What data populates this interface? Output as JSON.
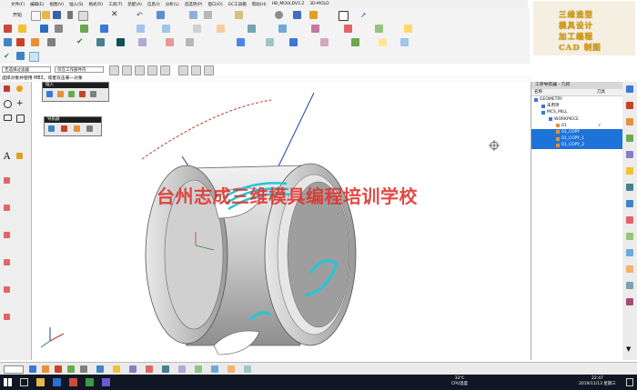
{
  "menu": [
    "文件(F)",
    "编辑(E)",
    "视图(V)",
    "插入(S)",
    "格式(R)",
    "工具(T)",
    "装配(A)",
    "信息(I)",
    "分析(L)",
    "首选项(P)",
    "窗口(O)",
    "GC工具箱",
    "帮助(H)",
    "HB_MOULDV5.2",
    "3D-MOLD"
  ],
  "brand": [
    "三维造型",
    "模具设计",
    "加工编程",
    "CAD 制图"
  ],
  "toolbar": {
    "start_label": "开始"
  },
  "combo": {
    "filter": "无选择过滤器",
    "scope": "仅在工作部件内"
  },
  "status_text": "选择对象并使用 MB3，或者双击某一对象",
  "float_insert": {
    "title": "插入"
  },
  "float_nav": {
    "title": "导航器"
  },
  "nav": {
    "title": "工序导航器 - 几何",
    "col_name": "名称",
    "col_tool": "刀具",
    "rows": [
      {
        "label": "GEOMETRY",
        "indent": 0,
        "selected": false,
        "check": ""
      },
      {
        "label": "未用项",
        "indent": 1,
        "selected": false,
        "check": ""
      },
      {
        "label": "MCS_MILL",
        "indent": 1,
        "selected": false,
        "check": ""
      },
      {
        "label": "WORKPIECE",
        "indent": 2,
        "selected": false,
        "check": ""
      },
      {
        "label": "01",
        "indent": 3,
        "selected": false,
        "check": "✔"
      },
      {
        "label": "01_COPY",
        "indent": 3,
        "selected": true,
        "check": ""
      },
      {
        "label": "01_COPY_1",
        "indent": 3,
        "selected": true,
        "check": ""
      },
      {
        "label": "01_COPY_2",
        "indent": 3,
        "selected": true,
        "check": ""
      }
    ]
  },
  "watermark": "台州志成三维模具编程培训学校",
  "taskbar": {
    "time": "22:47",
    "date": "2019/11/13 星期三",
    "cpu": "33℃",
    "cpu_label": "CPU温度"
  },
  "colors": {
    "selection": "#1e73d8",
    "brand_gold": "#d4a017",
    "watermark_red": "#e0312b",
    "taskbar": "#101623"
  }
}
